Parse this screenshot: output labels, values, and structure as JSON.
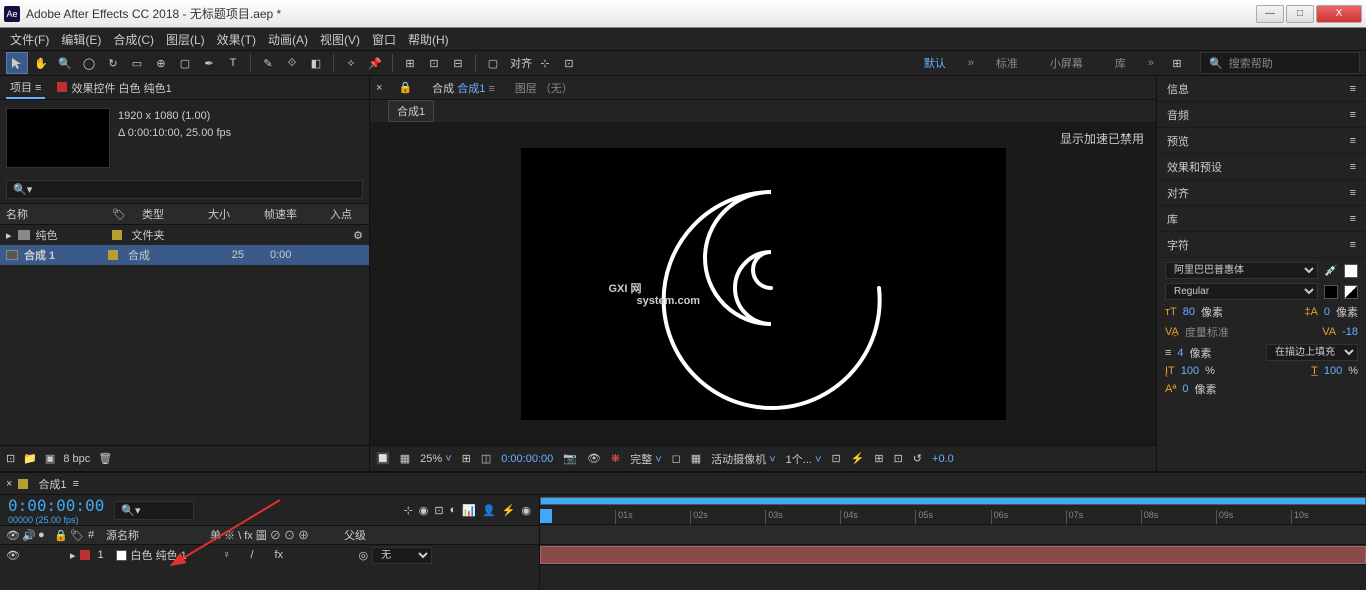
{
  "title": "Adobe After Effects CC 2018 - 无标题项目.aep *",
  "menus": [
    "文件(F)",
    "编辑(E)",
    "合成(C)",
    "图层(L)",
    "效果(T)",
    "动画(A)",
    "视图(V)",
    "窗口",
    "帮助(H)"
  ],
  "toolbar": {
    "align": "对齐"
  },
  "workspaces": {
    "default": "默认",
    "standard": "标准",
    "small": "小屏幕",
    "library": "库"
  },
  "search_placeholder": "搜索帮助",
  "project": {
    "tab": "项目",
    "effects_tab": "效果控件 白色 纯色1",
    "resolution": "1920 x 1080 (1.00)",
    "duration": "Δ 0:00:10:00, 25.00 fps",
    "cols": {
      "name": "名称",
      "type": "类型",
      "size": "大小",
      "fps": "帧速率",
      "in": "入点"
    },
    "items": [
      {
        "name": "纯色",
        "type": "文件夹"
      },
      {
        "name": "合成  1",
        "type": "合成",
        "fps": "25",
        "in": "0:00"
      }
    ],
    "bpc": "8 bpc"
  },
  "composition": {
    "tabs": {
      "comp": "合成",
      "active": "合成1",
      "layer": "图层 （无）"
    },
    "subtab": "合成1",
    "accel": "显示加速已禁用",
    "footer": {
      "zoom": "25%",
      "time": "0:00:00:00",
      "res": "完整",
      "camera": "活动摄像机",
      "views": "1个...",
      "offset": "+0.0"
    }
  },
  "right": {
    "info": "信息",
    "audio": "音频",
    "preview": "预览",
    "effects": "效果和预设",
    "align": "对齐",
    "library": "库",
    "character": "字符",
    "font": "阿里巴巴普惠体",
    "style": "Regular",
    "size": "80",
    "size_unit": "像素",
    "leading": "0",
    "leading_unit": "像素",
    "tracking_label": "度量标准",
    "tracking": "-18",
    "stroke": "4",
    "stroke_unit": "像素",
    "stroke_fill": "在描边上填充",
    "hscale": "100",
    "hscale_unit": "%",
    "vscale": "100",
    "vscale_unit": "%",
    "baseline": "0",
    "baseline_unit": "像素"
  },
  "timeline": {
    "tab": "合成1",
    "timecode": "0:00:00:00",
    "fps": "00000 (25.00 fps)",
    "cols": {
      "num": "#",
      "source": "源名称",
      "switches": "单 ※ \\ fx 圖 ⊘ ⊙ ⊕",
      "parent": "父级"
    },
    "layer": {
      "num": "1",
      "name": "白色 纯色  1",
      "parent": "无"
    },
    "ticks": [
      "",
      "01s",
      "02s",
      "03s",
      "04s",
      "05s",
      "06s",
      "07s",
      "08s",
      "09s",
      "10s"
    ]
  },
  "watermark": {
    "main": "GXI 网",
    "sub": "system.com"
  }
}
